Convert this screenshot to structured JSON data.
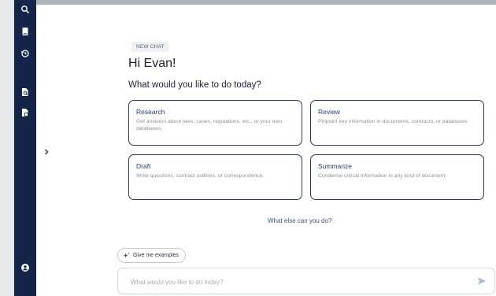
{
  "badge": "NEW CHAT",
  "greeting": "Hi Evan!",
  "question": "What would you like to do today?",
  "cards": [
    {
      "title": "Research",
      "desc": "Get answers about laws, cases, regulations, etc., or your own databases."
    },
    {
      "title": "Review",
      "desc": "Pinpoint key information in documents, contracts, or databases."
    },
    {
      "title": "Draft",
      "desc": "Write questions, contract outlines, or correspondence."
    },
    {
      "title": "Summarize",
      "desc": "Condense critical information in any kind of document."
    }
  ],
  "else_link": "What else can you do?",
  "chip_label": "Give me examples",
  "input": {
    "placeholder": "What would you like to do today?",
    "value": ""
  },
  "sidebar_icons": [
    "search-icon",
    "book-icon",
    "history-icon",
    "document-search-icon",
    "document-icon",
    "account-icon"
  ],
  "colors": {
    "sidebar": "#152449",
    "accent": "#2a3a78",
    "send": "#a9b6dd"
  }
}
